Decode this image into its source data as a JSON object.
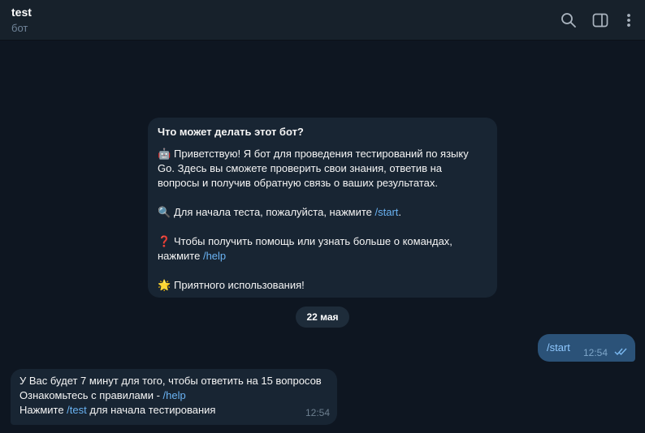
{
  "header": {
    "title": "test",
    "subtitle": "бот",
    "icons": [
      "search-icon",
      "sidebar-toggle-icon",
      "more-vertical-icon"
    ]
  },
  "intro": {
    "title": "Что может делать этот бот?",
    "p1_emoji": "🤖",
    "p1_l1": "Приветствую! Я бот для проведения тестирований по языку",
    "p1_l2": "Go. Здесь вы сможете проверить свои знания, ответив на",
    "p1_l3": "вопросы и получив обратную связь о ваших результатах.",
    "p2_emoji": "🔍",
    "p2_text": "Для начала теста, пожалуйста, нажмите ",
    "p2_cmd": "/start",
    "p2_end": ".",
    "p3_emoji": "❓",
    "p3_l1": "Чтобы получить помощь или узнать больше о командах,",
    "p3_l2": "нажмите ",
    "p3_cmd": "/help",
    "p4_emoji": "🌟",
    "p4_text": "Приятного использования!"
  },
  "date_chip": "22 мая",
  "outgoing": {
    "text": "/start",
    "time": "12:54",
    "status": "read"
  },
  "incoming": {
    "l1": "У Вас будет 7 минут для того, чтобы ответить на 15 вопросов",
    "l2": "Ознакомьтесь с правилами - ",
    "l2_cmd": "/help",
    "l3": "Нажмите ",
    "l3_cmd": "/test",
    "l3_end": " для начала тестирования",
    "time": "12:54"
  },
  "colors": {
    "background": "#0e1621",
    "header": "#17212b",
    "bubble_in": "#182533",
    "bubble_out": "#2b5278",
    "link": "#6ab3f3"
  }
}
